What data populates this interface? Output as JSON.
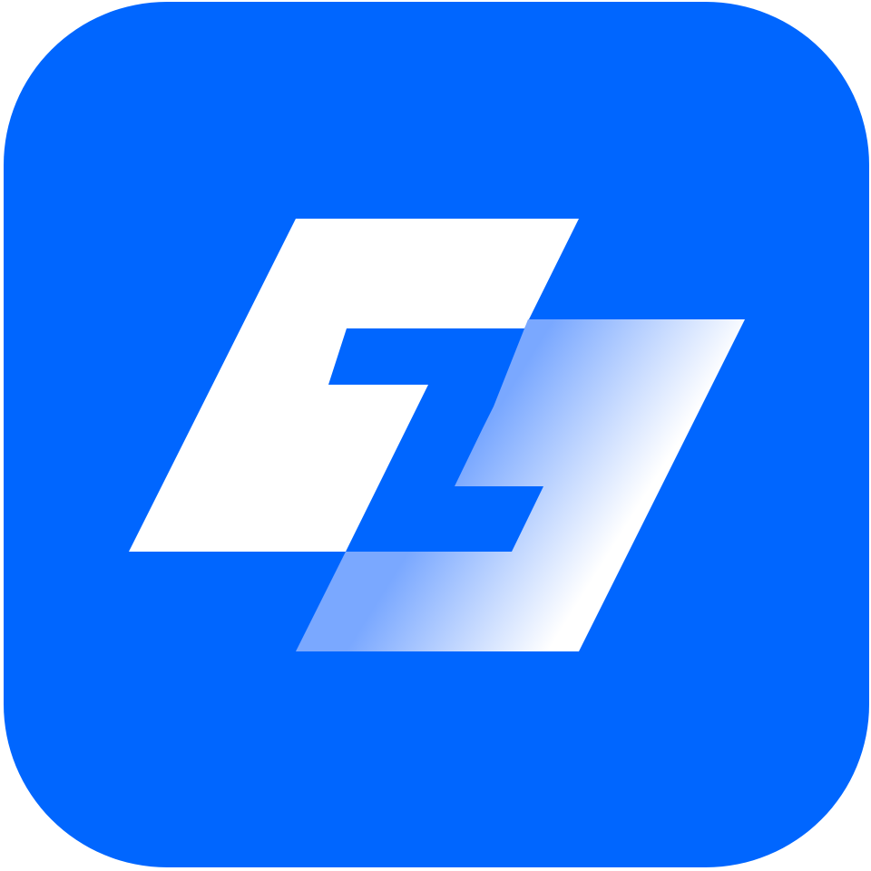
{
  "app_icon": {
    "icon": "app-logo-icon",
    "background_color": "#0066ff",
    "glyph_color": "#ffffff",
    "gradient_start_color": "#7aa8ff",
    "gradient_end_color": "#ffffff"
  }
}
